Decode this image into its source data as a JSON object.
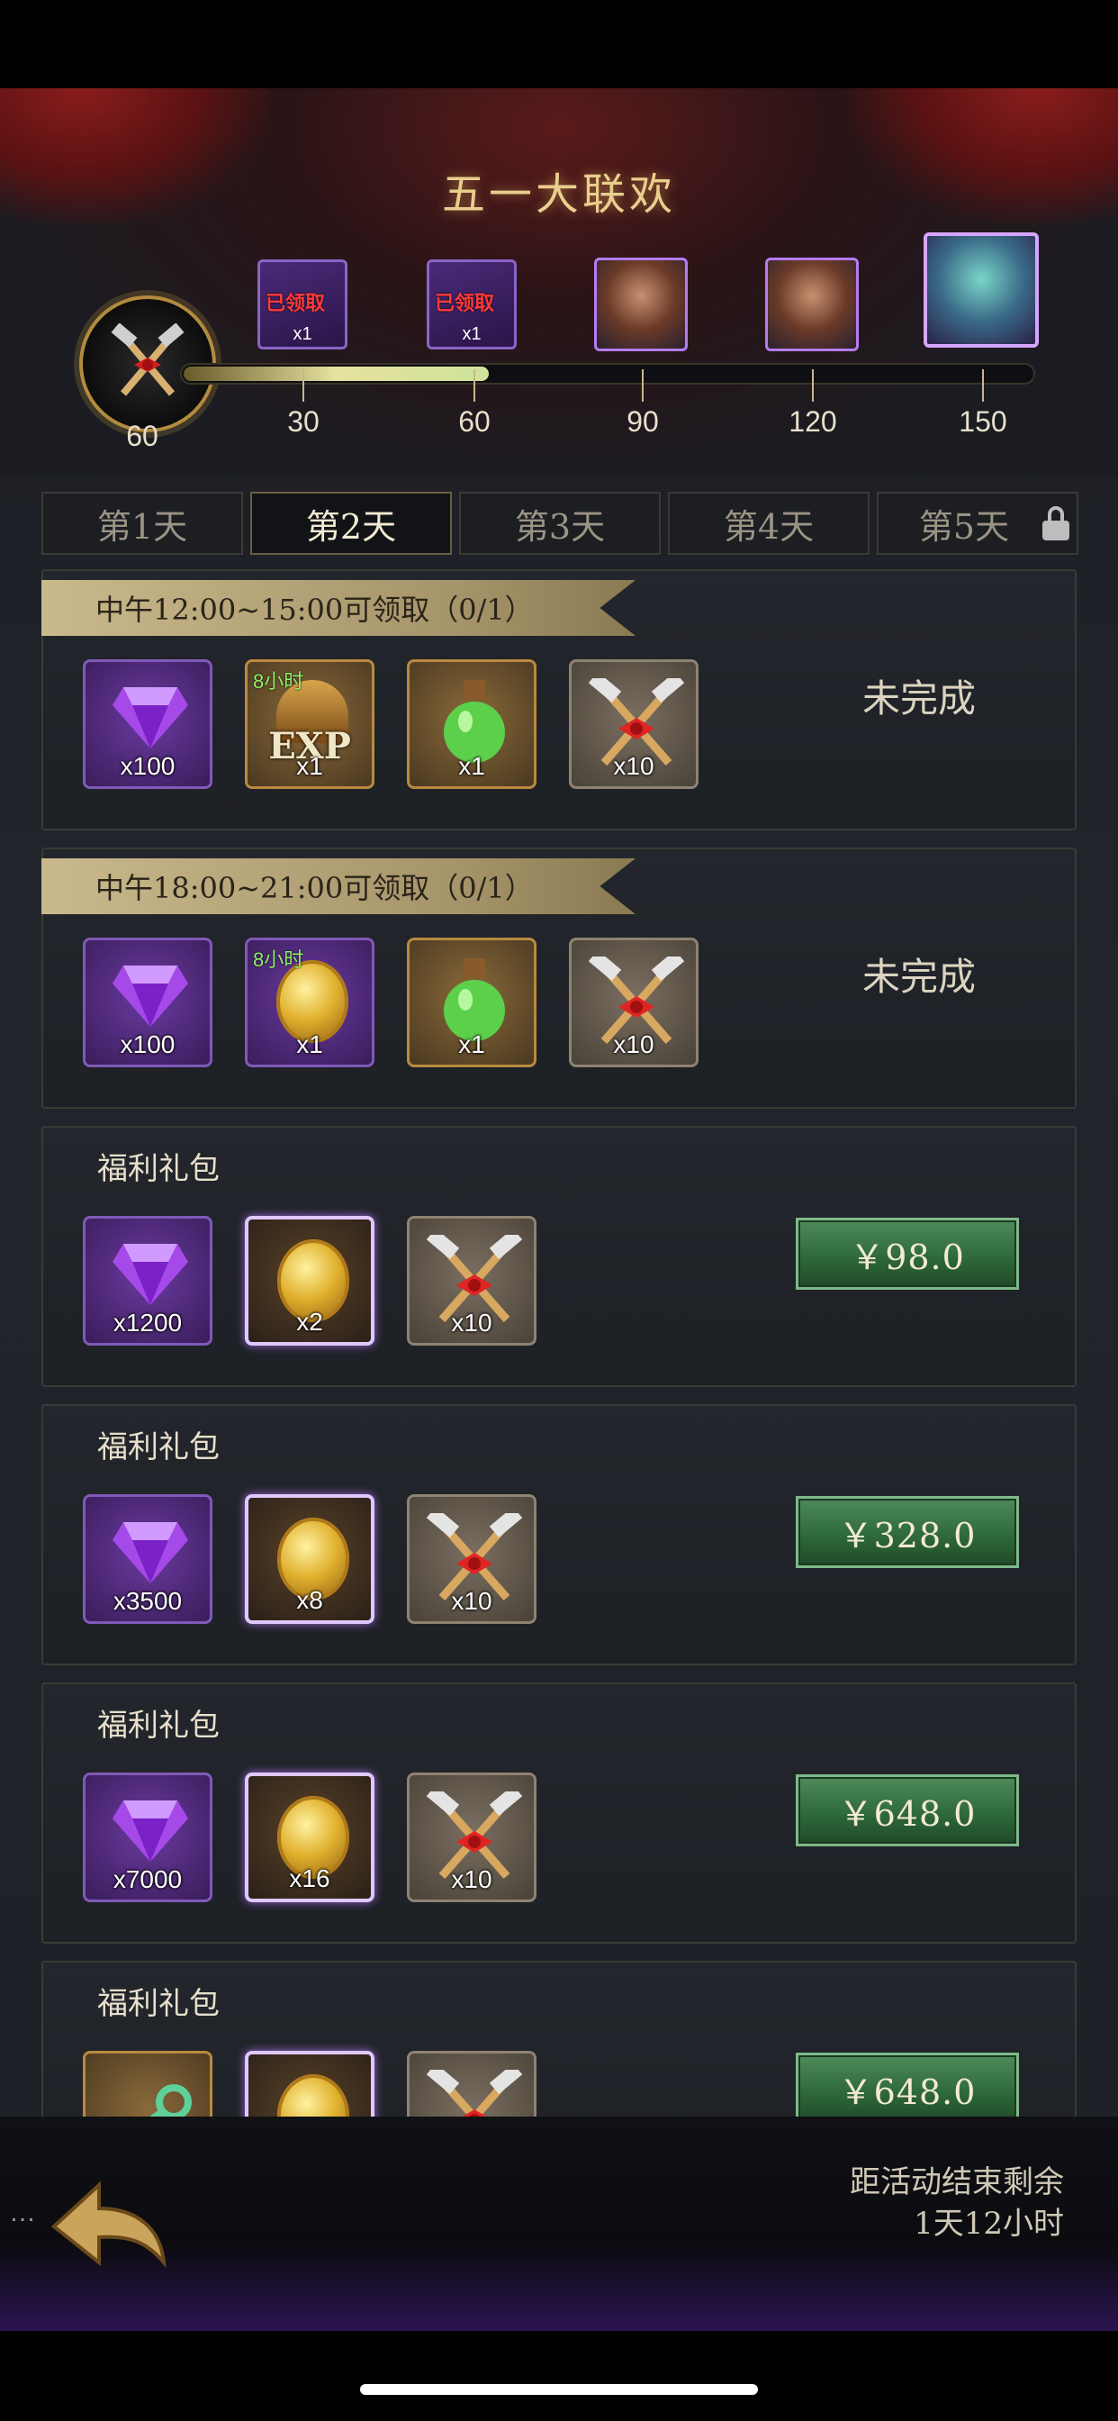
{
  "header": {
    "title": "五一大联欢",
    "current_points": "60",
    "milestones": [
      {
        "value": "30",
        "reward": "chest",
        "claimed": "已领取",
        "count": "x1"
      },
      {
        "value": "60",
        "reward": "chest",
        "claimed": "已领取",
        "count": "x1"
      },
      {
        "value": "90",
        "reward": "hero-portrait"
      },
      {
        "value": "120",
        "reward": "hero-portrait"
      },
      {
        "value": "150",
        "reward": "hero-portrait"
      }
    ],
    "progress_fraction": 0.36
  },
  "tabs": [
    {
      "label": "第1天",
      "active": false
    },
    {
      "label": "第2天",
      "active": true
    },
    {
      "label": "第3天",
      "active": false
    },
    {
      "label": "第4天",
      "active": false
    },
    {
      "label": "第5天",
      "active": false,
      "locked": true
    }
  ],
  "tasks": [
    {
      "title": "中午12:00~15:00可领取（0/1）",
      "status": "未完成",
      "items": [
        {
          "icon": "purple-gem-icon",
          "count": "x100"
        },
        {
          "icon": "exp-helmet-icon",
          "timer": "8小时",
          "label": "EXP",
          "count": "x1"
        },
        {
          "icon": "green-potion-icon",
          "count": "x1"
        },
        {
          "icon": "crossed-hammers-icon",
          "count": "x10"
        }
      ]
    },
    {
      "title": "中午18:00~21:00可领取（0/1）",
      "status": "未完成",
      "items": [
        {
          "icon": "purple-gem-icon",
          "count": "x100"
        },
        {
          "icon": "gold-coin-icon",
          "timer": "8小时",
          "count": "x1"
        },
        {
          "icon": "green-potion-icon",
          "count": "x1"
        },
        {
          "icon": "crossed-hammers-icon",
          "count": "x10"
        }
      ]
    }
  ],
  "packs": [
    {
      "title": "福利礼包",
      "price": "￥98.0",
      "items": [
        {
          "icon": "purple-gem-icon",
          "count": "x1200"
        },
        {
          "icon": "gold-crown-coin-icon",
          "count": "x2"
        },
        {
          "icon": "crossed-hammers-icon",
          "count": "x10"
        }
      ]
    },
    {
      "title": "福利礼包",
      "price": "￥328.0",
      "items": [
        {
          "icon": "purple-gem-icon",
          "count": "x3500"
        },
        {
          "icon": "gold-crown-coin-icon",
          "count": "x8"
        },
        {
          "icon": "crossed-hammers-icon",
          "count": "x10"
        }
      ]
    },
    {
      "title": "福利礼包",
      "price": "￥648.0",
      "items": [
        {
          "icon": "purple-gem-icon",
          "count": "x7000"
        },
        {
          "icon": "gold-crown-coin-icon",
          "count": "x16"
        },
        {
          "icon": "crossed-hammers-icon",
          "count": "x10"
        }
      ]
    },
    {
      "title": "福利礼包",
      "price": "￥648.0",
      "items": [
        {
          "icon": "green-key-icon",
          "count": ""
        },
        {
          "icon": "gold-crown-coin-icon",
          "count": ""
        },
        {
          "icon": "crossed-hammers-icon",
          "count": ""
        }
      ]
    }
  ],
  "footer": {
    "dots": "…",
    "countdown_label": "距活动结束剩余",
    "countdown_value": "1天12小时"
  },
  "colors": {
    "accent_gold": "#e9cf8e",
    "buy_green": "#2f6a3a",
    "timer_green": "#8fef6a",
    "claimed_red": "#ff3a3a"
  }
}
